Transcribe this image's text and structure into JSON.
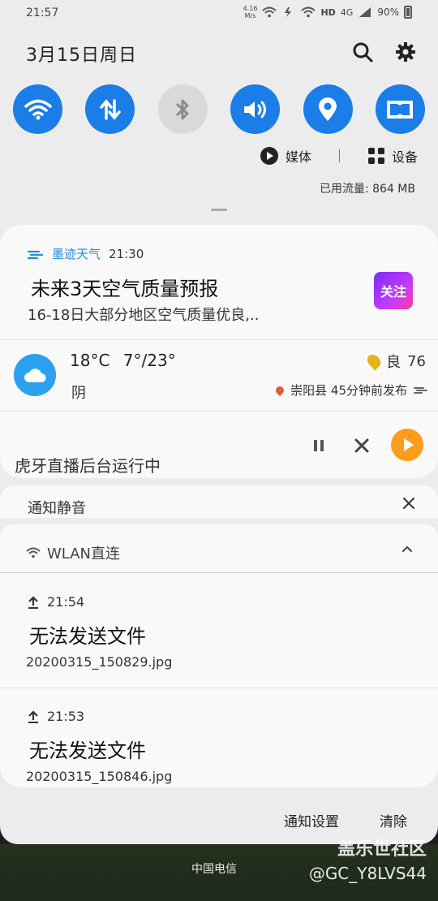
{
  "status_bar": {
    "time": "21:57",
    "net_speed_value": "4.16",
    "net_speed_unit": "M/s",
    "hd_label": "HD",
    "network_type": "4G",
    "battery": "90%"
  },
  "date": "3月15日周日",
  "quick_settings": [
    {
      "name": "wifi",
      "icon": "wifi-icon",
      "on": true
    },
    {
      "name": "mobile-data",
      "icon": "data-arrows-icon",
      "on": true
    },
    {
      "name": "bluetooth",
      "icon": "bluetooth-icon",
      "on": false
    },
    {
      "name": "sound",
      "icon": "speaker-icon",
      "on": true
    },
    {
      "name": "location",
      "icon": "location-pin-icon",
      "on": true
    },
    {
      "name": "dolby",
      "icon": "dolby-icon",
      "on": true
    }
  ],
  "media_row": {
    "media_label": "媒体",
    "devices_label": "设备"
  },
  "data_usage": "已用流量: 864 MB",
  "weather_notification": {
    "app_name": "墨迹天气",
    "time": "21:30",
    "title": "未来3天空气质量预报",
    "subtitle": "16-18日大部分地区空气质量优良,..",
    "follow_label": "关注"
  },
  "weather_widget": {
    "temp": "18°C",
    "range": "7°/23°",
    "condition": "阴",
    "aqi_label": "良",
    "aqi_value": "76",
    "published": "崇阳县 45分钟前发布"
  },
  "live_notification": {
    "text": "虎牙直播后台运行中"
  },
  "silent_section": {
    "label": "通知静音"
  },
  "wlan_section": {
    "title": "WLAN直连",
    "items": [
      {
        "time": "21:54",
        "message": "无法发送文件",
        "file": "20200315_150829.jpg"
      },
      {
        "time": "21:53",
        "message": "无法发送文件",
        "file": "20200315_150846.jpg"
      }
    ]
  },
  "bottom": {
    "settings_label": "通知设置",
    "clear_label": "清除"
  },
  "lock_screen": {
    "carrier": "中国电信"
  },
  "watermark": {
    "line1": "盖乐世社区",
    "line2": "@GC_Y8LVS44"
  },
  "colors": {
    "accent": "#1a7de8",
    "weather_blue": "#2aa0ef",
    "shade_bg": "#ececec"
  }
}
